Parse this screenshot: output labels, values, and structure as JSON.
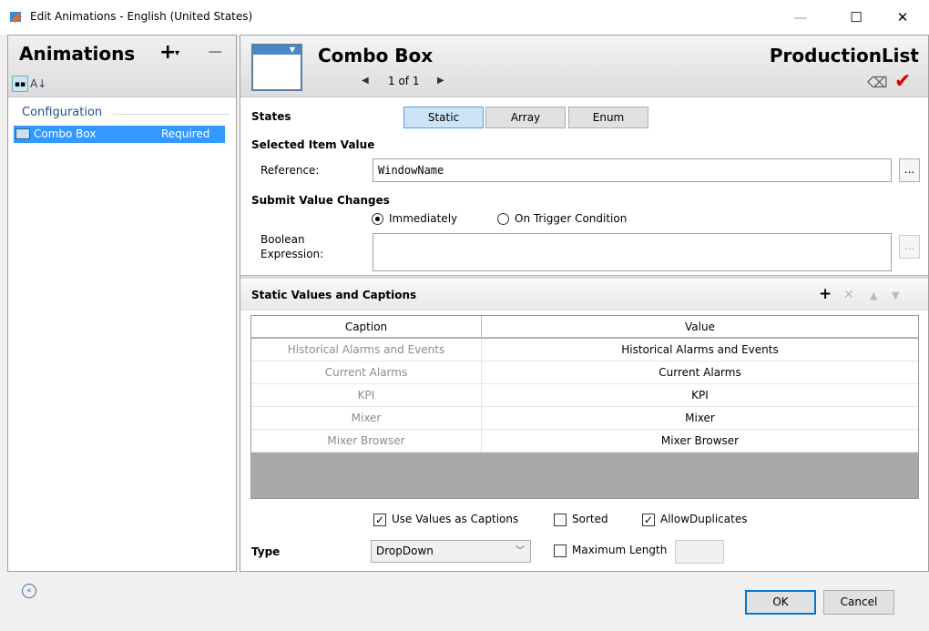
{
  "window": {
    "title": "Edit Animations - English (United States)",
    "minimize_glyph": "—",
    "maximize_glyph": "☐",
    "close_glyph": "✕"
  },
  "left": {
    "title": "Animations",
    "add_glyph": "+",
    "add_caret": "▾",
    "remove_glyph": "−",
    "category_label": "Configuration",
    "items": [
      {
        "name": "Combo Box",
        "status": "Required"
      }
    ]
  },
  "header": {
    "title": "Combo Box",
    "pager_text": "1 of 1",
    "prev_glyph": "◀",
    "next_glyph": "▶",
    "element_name": "ProductionList",
    "eraser_glyph": "⌫",
    "check_glyph": "✔"
  },
  "states": {
    "label": "States",
    "options": [
      "Static",
      "Array",
      "Enum"
    ],
    "selected": "Static"
  },
  "selected_item_value": {
    "label": "Selected Item Value",
    "reference_label": "Reference:",
    "reference_value": "WindowName",
    "browse_label": "..."
  },
  "submit": {
    "label": "Submit Value Changes",
    "option_immediately": "Immediately",
    "option_trigger": "On Trigger Condition",
    "selected": "Immediately",
    "boolean_label_1": "Boolean",
    "boolean_label_2": "Expression:",
    "boolean_value": "",
    "browse_label": "..."
  },
  "static_values": {
    "label": "Static Values and Captions",
    "columns": [
      "Caption",
      "Value"
    ],
    "rows": [
      {
        "caption": "Historical Alarms and Events",
        "value": "Historical Alarms and Events"
      },
      {
        "caption": "Current Alarms",
        "value": "Current Alarms"
      },
      {
        "caption": "KPI",
        "value": "KPI"
      },
      {
        "caption": "Mixer",
        "value": "Mixer"
      },
      {
        "caption": "Mixer Browser",
        "value": "Mixer Browser"
      }
    ]
  },
  "options": {
    "use_values_as_captions": {
      "label": "Use Values as Captions",
      "checked": true
    },
    "sorted": {
      "label": "Sorted",
      "checked": false
    },
    "allow_duplicates": {
      "label": "AllowDuplicates",
      "checked": true
    },
    "maximum_length": {
      "label": "Maximum Length",
      "checked": false,
      "value": ""
    }
  },
  "type": {
    "label": "Type",
    "value": "DropDown"
  },
  "footer": {
    "ok_label": "OK",
    "cancel_label": "Cancel",
    "collapse_glyph": "«"
  },
  "colors": {
    "selection": "#3399ff",
    "active_segment": "#cce4f7",
    "accent_check": "#dd0000"
  }
}
